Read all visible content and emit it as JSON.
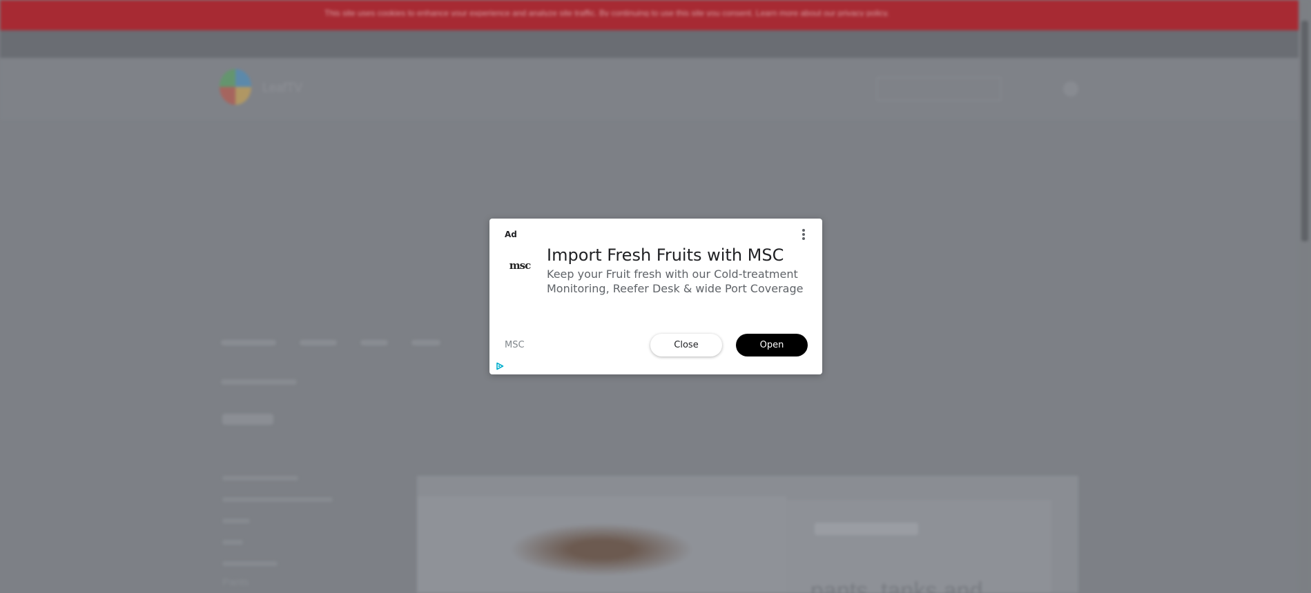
{
  "background": {
    "banner_text": "This site uses cookies to enhance your experience and analyze site traffic. By continuing to use this site you consent. Learn more about our privacy policy.",
    "logo_text": "LeafTV",
    "sidebar_visible_item": "Pants",
    "hero_heading": "pants, tanks and"
  },
  "ad": {
    "label": "Ad",
    "headline": "Import Fresh Fruits with MSC",
    "description": "Keep your Fruit fresh with our Cold-treatment Monitoring, Reefer Desk & wide Port Coverage",
    "advertiser": "MSC",
    "brand_logo_text": "msc",
    "close_label": "Close",
    "open_label": "Open",
    "icons": [
      "more-options-icon",
      "adchoices-icon"
    ]
  },
  "colors": {
    "banner": "#a72a33",
    "overlay": "#7d8086",
    "open_button": "#000000",
    "adchoices": "#00aecd"
  }
}
